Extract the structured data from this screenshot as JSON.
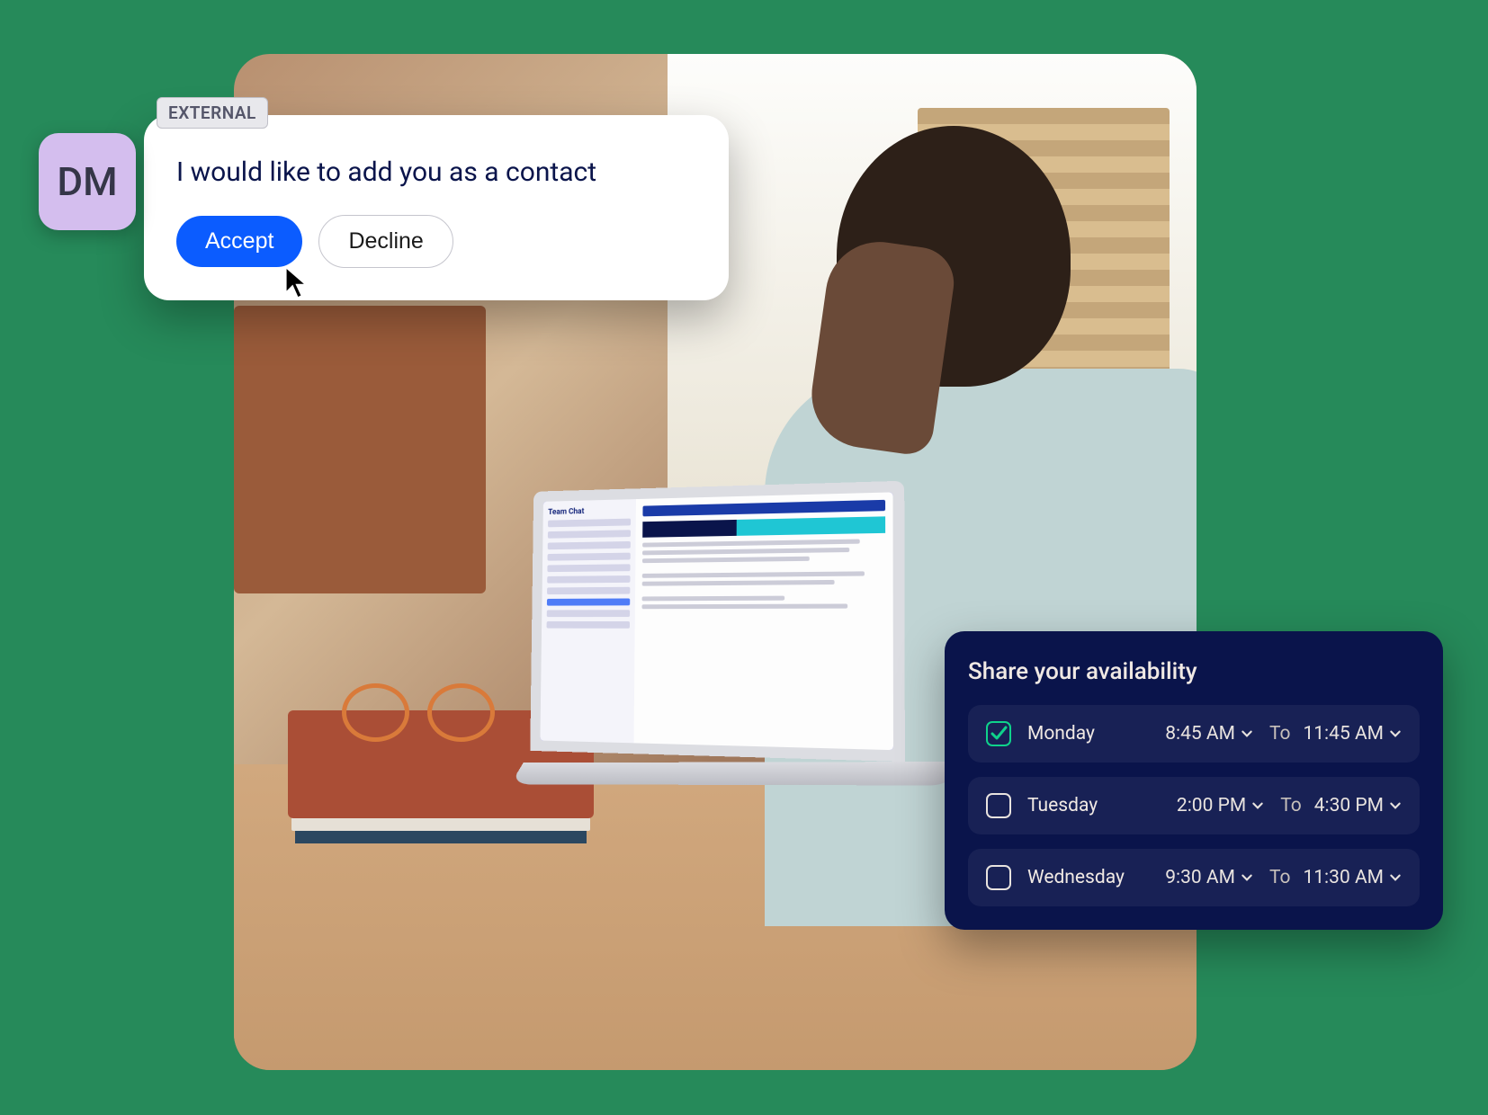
{
  "avatar": {
    "initials": "DM"
  },
  "external_tag": "EXTERNAL",
  "request": {
    "message": "I would like to add you as a contact",
    "accept": "Accept",
    "decline": "Decline"
  },
  "laptop": {
    "sidebar_title": "Team Chat"
  },
  "availability": {
    "title": "Share your availability",
    "rows": [
      {
        "checked": true,
        "day": "Monday",
        "start": "8:45 AM",
        "to": "To",
        "end": "11:45 AM"
      },
      {
        "checked": false,
        "day": "Tuesday",
        "start": "2:00 PM",
        "to": "To",
        "end": "4:30 PM"
      },
      {
        "checked": false,
        "day": "Wednesday",
        "start": "9:30 AM",
        "to": "To",
        "end": "11:30 AM"
      }
    ]
  }
}
